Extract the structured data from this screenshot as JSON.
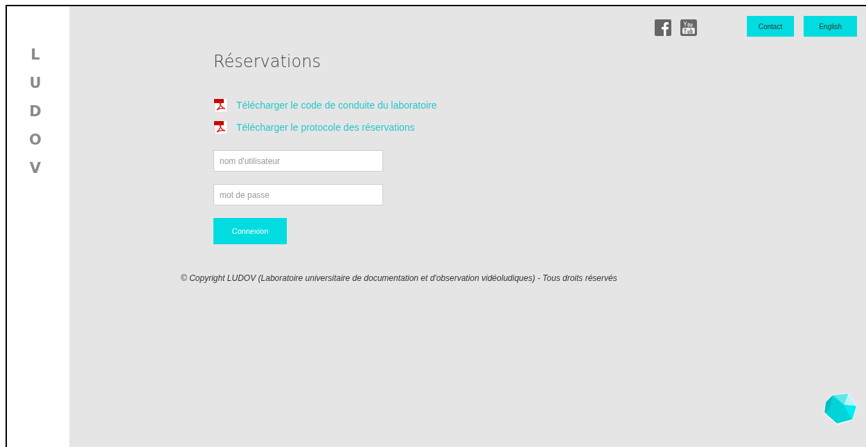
{
  "logo": {
    "text": "LUDOV"
  },
  "header": {
    "buttons": [
      "Contact",
      "English"
    ]
  },
  "page": {
    "title": "Réservations",
    "downloads": [
      "Télécharger le code de conduite du laboratoire",
      "Télécharger le protocole des réservations"
    ],
    "login": {
      "username": {
        "placeholder": "nom d'utilisateur"
      },
      "password": {
        "placeholder": "mot de passe"
      },
      "submit": "Connexion"
    }
  },
  "footer": {
    "copyright": "© Copyright LUDOV (Laboratoire universitaire de documentation et d'observation vidéoludiques) - Tous droits réservés"
  }
}
